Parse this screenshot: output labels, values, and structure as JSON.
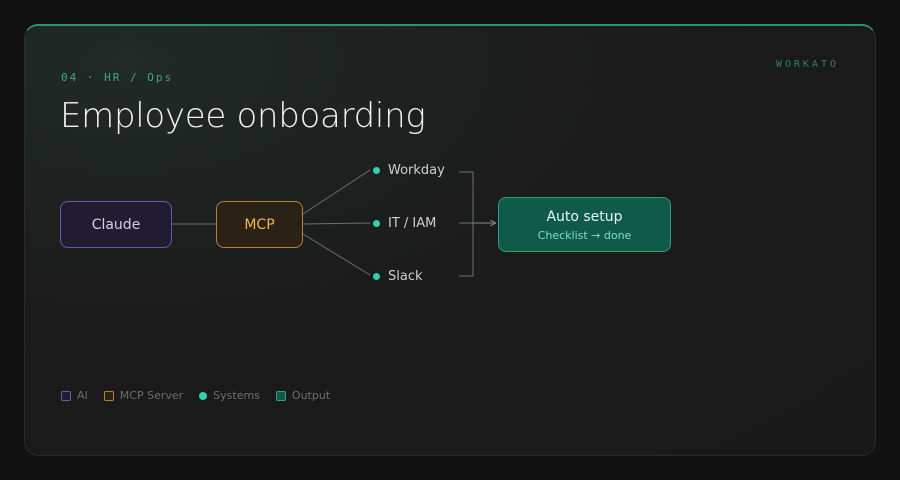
{
  "header": {
    "eyebrow": "04 · HR / Ops",
    "brand": "WORKATO",
    "title": "Employee onboarding"
  },
  "diagram": {
    "nodes": {
      "ai": "Claude",
      "server": "MCP",
      "output": {
        "label": "Auto setup",
        "sublabel": "Checklist → done"
      }
    },
    "systems": [
      "Workday",
      "IT / IAM",
      "Slack"
    ]
  },
  "legend": {
    "ai": "AI",
    "server": "MCP Server",
    "systems": "Systems",
    "output": "Output"
  },
  "colors": {
    "ai": "#6a55a8",
    "server": "#b5832e",
    "systems": "#2ed1b0",
    "output": "#2f9d82",
    "accent": "#3fa58d"
  }
}
